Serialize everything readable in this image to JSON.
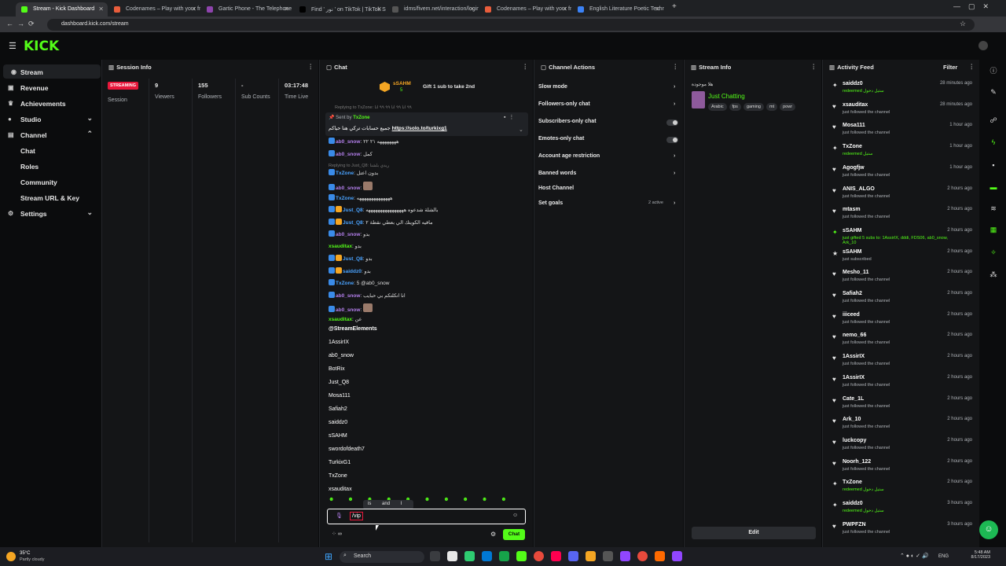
{
  "browser": {
    "tabs": [
      {
        "label": "Stream - Kick Dashboard",
        "color": "#53fc18"
      },
      {
        "label": "Codenames – Play with your fr",
        "color": "#e85d3c"
      },
      {
        "label": "Gartic Phone - The Telephone G",
        "color": "#8e44ad"
      },
      {
        "label": "Find ' نور ' on TikTok | TikTok Se",
        "color": "#000000"
      },
      {
        "label": "idms/fivem.net/interaction/login",
        "color": "#555555"
      },
      {
        "label": "Codenames – Play with your fr",
        "color": "#e85d3c"
      },
      {
        "label": "English Literature Poetic Techn",
        "color": "#3b82f6"
      }
    ],
    "url": "dashboard.kick.com/stream"
  },
  "brand": {
    "logo": "KICK",
    "accent": "#53fc18"
  },
  "sidebar": {
    "items": [
      {
        "label": "Stream",
        "icon": "broadcast-icon"
      },
      {
        "label": "Revenue",
        "icon": "wallet-icon"
      },
      {
        "label": "Achievements",
        "icon": "trophy-icon"
      },
      {
        "label": "Studio",
        "icon": "camera-icon"
      },
      {
        "label": "Channel",
        "icon": "channel-icon"
      },
      {
        "label": "Chat"
      },
      {
        "label": "Roles"
      },
      {
        "label": "Community"
      },
      {
        "label": "Stream URL & Key"
      },
      {
        "label": "Settings",
        "icon": "gear-icon"
      }
    ]
  },
  "session": {
    "title": "Session Info",
    "status": "STREAMING",
    "status_sub": "Session",
    "stats": [
      {
        "value": "9",
        "label": "Viewers"
      },
      {
        "value": "155",
        "label": "Followers"
      },
      {
        "value": "-",
        "label": "Sub Counts"
      },
      {
        "value": "03:17:48",
        "label": "Time Live"
      }
    ]
  },
  "chat": {
    "title": "Chat",
    "gifter": "sSAHM",
    "gifter_count": "5",
    "gift_text": "Gift 1 sub to take 2nd",
    "reply_hint": "Replying to TxZone: ٩٩ انا ٩٩ انا ٩٩ ٩٩ انا",
    "pinned_by": "Sent by",
    "pinned_user": "TxZone",
    "pinned_text": "جميع حسابات تركي هنا حياكم",
    "pinned_link": "https://solo.to/turkixg1",
    "messages": [
      {
        "user": "ab0_snow",
        "text": "ههههههههه ٢١ ٢٢",
        "color": "#b37feb"
      },
      {
        "user": "ab0_snow",
        "text": "كمل",
        "color": "#b37feb"
      },
      {
        "user": "TxZone",
        "text": "بدون اعتل",
        "color": "#4aa3ff",
        "reply": "Replying to Just_Q8: ريدي بلشنا"
      },
      {
        "user": "ab0_snow",
        "text": "",
        "color": "#b37feb"
      },
      {
        "user": "TxZone",
        "text": "ههههههههههههههه",
        "color": "#4aa3ff"
      },
      {
        "user": "Just_Q8",
        "text": "بالشلة شدعوه ههههههههههههههههه",
        "color": "#4aa3ff"
      },
      {
        "user": "Just_Q8",
        "text": "مافيه الكويتك الي بعطي نقطة ٢",
        "color": "#4aa3ff"
      },
      {
        "user": "ab0_snow",
        "text": "بدو",
        "color": "#b37feb"
      },
      {
        "user": "xsauditax",
        "text": "بدو",
        "color": "#53fc18"
      },
      {
        "user": "Just_Q8",
        "text": "بدو",
        "color": "#4aa3ff"
      },
      {
        "user": "saiddz0",
        "text": "بدو",
        "color": "#4aa3ff"
      },
      {
        "user": "TxZone",
        "text": "5 @ab0_snow",
        "color": "#4aa3ff"
      },
      {
        "user": "ab0_snow",
        "text": "انا انكلتكم بي حبايب",
        "color": "#b37feb"
      },
      {
        "user": "ab0_snow",
        "text": "",
        "color": "#b37feb"
      },
      {
        "user": "xsauditax",
        "text": "عن",
        "color": "#53fc18"
      }
    ],
    "suggestions": [
      "@StreamElements",
      "1AssirIX",
      "ab0_snow",
      "BotRix",
      "Just_Q8",
      "Mosa111",
      "Safiah2",
      "saiddz0",
      "sSAHM",
      "swordofdeath7",
      "TurkixG1",
      "TxZone",
      "xsauditax"
    ],
    "tooltip": [
      "is",
      "and",
      "I"
    ],
    "input_value": "/vip",
    "send_label": "Chat",
    "points": "∞"
  },
  "actions": {
    "title": "Channel Actions",
    "items": [
      {
        "label": "Slow mode",
        "kind": "arrow"
      },
      {
        "label": "Followers-only chat",
        "kind": "arrow"
      },
      {
        "label": "Subscribers-only chat",
        "kind": "toggle"
      },
      {
        "label": "Emotes-only chat",
        "kind": "toggle"
      },
      {
        "label": "Account age restriction",
        "kind": "arrow"
      },
      {
        "label": "Banned words",
        "kind": "arrow"
      },
      {
        "label": "Host Channel",
        "kind": "none"
      },
      {
        "label": "Set goals",
        "kind": "arrow",
        "extra": "2 active"
      }
    ]
  },
  "streaminfo": {
    "title": "Stream Info",
    "stream_title": "هلا موجودة",
    "category": "Just Chatting",
    "tags": [
      "Arabic",
      "fps",
      "gaming",
      "mt",
      "powr"
    ],
    "edit_label": "Edit"
  },
  "activity": {
    "title": "Activity Feed",
    "filter": "Filter",
    "items": [
      {
        "user": "saiddz0",
        "desc": "redeemed ستيل دخول",
        "time": "28 minutes ago",
        "icon": "gift-icon",
        "green": true
      },
      {
        "user": "xsauditax",
        "desc": "just followed the channel",
        "time": "28 minutes ago",
        "icon": "heart-icon"
      },
      {
        "user": "Mosa111",
        "desc": "just followed the channel",
        "time": "1 hour ago",
        "icon": "heart-icon"
      },
      {
        "user": "TxZone",
        "desc": "redeemed ستيل",
        "time": "1 hour ago",
        "icon": "gift-icon",
        "green": true
      },
      {
        "user": "Agogfjw",
        "desc": "just followed the channel",
        "time": "1 hour ago",
        "icon": "heart-icon"
      },
      {
        "user": "ANIS_ALGO",
        "desc": "just followed the channel",
        "time": "2 hours ago",
        "icon": "heart-icon"
      },
      {
        "user": "mtasm",
        "desc": "just followed the channel",
        "time": "2 hours ago",
        "icon": "heart-icon"
      },
      {
        "user": "sSAHM",
        "desc": "just gifted 5 subs to: 1AssirIX, dddi, FDS06, ab0_snow, Ark_10",
        "time": "2 hours ago",
        "icon": "gift-icon",
        "green": true
      },
      {
        "user": "sSAHM",
        "desc": "just subscribed",
        "time": "2 hours ago",
        "icon": "star-icon"
      },
      {
        "user": "Mesho_11",
        "desc": "just followed the channel",
        "time": "2 hours ago",
        "icon": "heart-icon"
      },
      {
        "user": "Safiah2",
        "desc": "just followed the channel",
        "time": "2 hours ago",
        "icon": "heart-icon"
      },
      {
        "user": "iiiceed",
        "desc": "just followed the channel",
        "time": "2 hours ago",
        "icon": "heart-icon"
      },
      {
        "user": "nemo_66",
        "desc": "just followed the channel",
        "time": "2 hours ago",
        "icon": "heart-icon"
      },
      {
        "user": "1AssirIX",
        "desc": "just followed the channel",
        "time": "2 hours ago",
        "icon": "heart-icon"
      },
      {
        "user": "1AssirIX",
        "desc": "just followed the channel",
        "time": "2 hours ago",
        "icon": "heart-icon"
      },
      {
        "user": "Cate_1L",
        "desc": "just followed the channel",
        "time": "2 hours ago",
        "icon": "heart-icon"
      },
      {
        "user": "Ark_10",
        "desc": "just followed the channel",
        "time": "2 hours ago",
        "icon": "heart-icon"
      },
      {
        "user": "luckcopy",
        "desc": "just followed the channel",
        "time": "2 hours ago",
        "icon": "heart-icon"
      },
      {
        "user": "Noorh_122",
        "desc": "just followed the channel",
        "time": "2 hours ago",
        "icon": "heart-icon"
      },
      {
        "user": "TxZone",
        "desc": "redeemed ستيل دخول",
        "time": "2 hours ago",
        "icon": "gift-icon",
        "green": true
      },
      {
        "user": "saiddz0",
        "desc": "redeemed ستيل دخول",
        "time": "3 hours ago",
        "icon": "gift-icon",
        "green": true
      },
      {
        "user": "PWPFZN",
        "desc": "just followed the channel",
        "time": "3 hours ago",
        "icon": "heart-icon"
      }
    ]
  },
  "taskbar": {
    "weather_temp": "35°C",
    "weather_text": "Partly cloudy",
    "search": "Search",
    "lang": "ENG",
    "time": "5:48 AM",
    "date": "8/17/2023"
  }
}
